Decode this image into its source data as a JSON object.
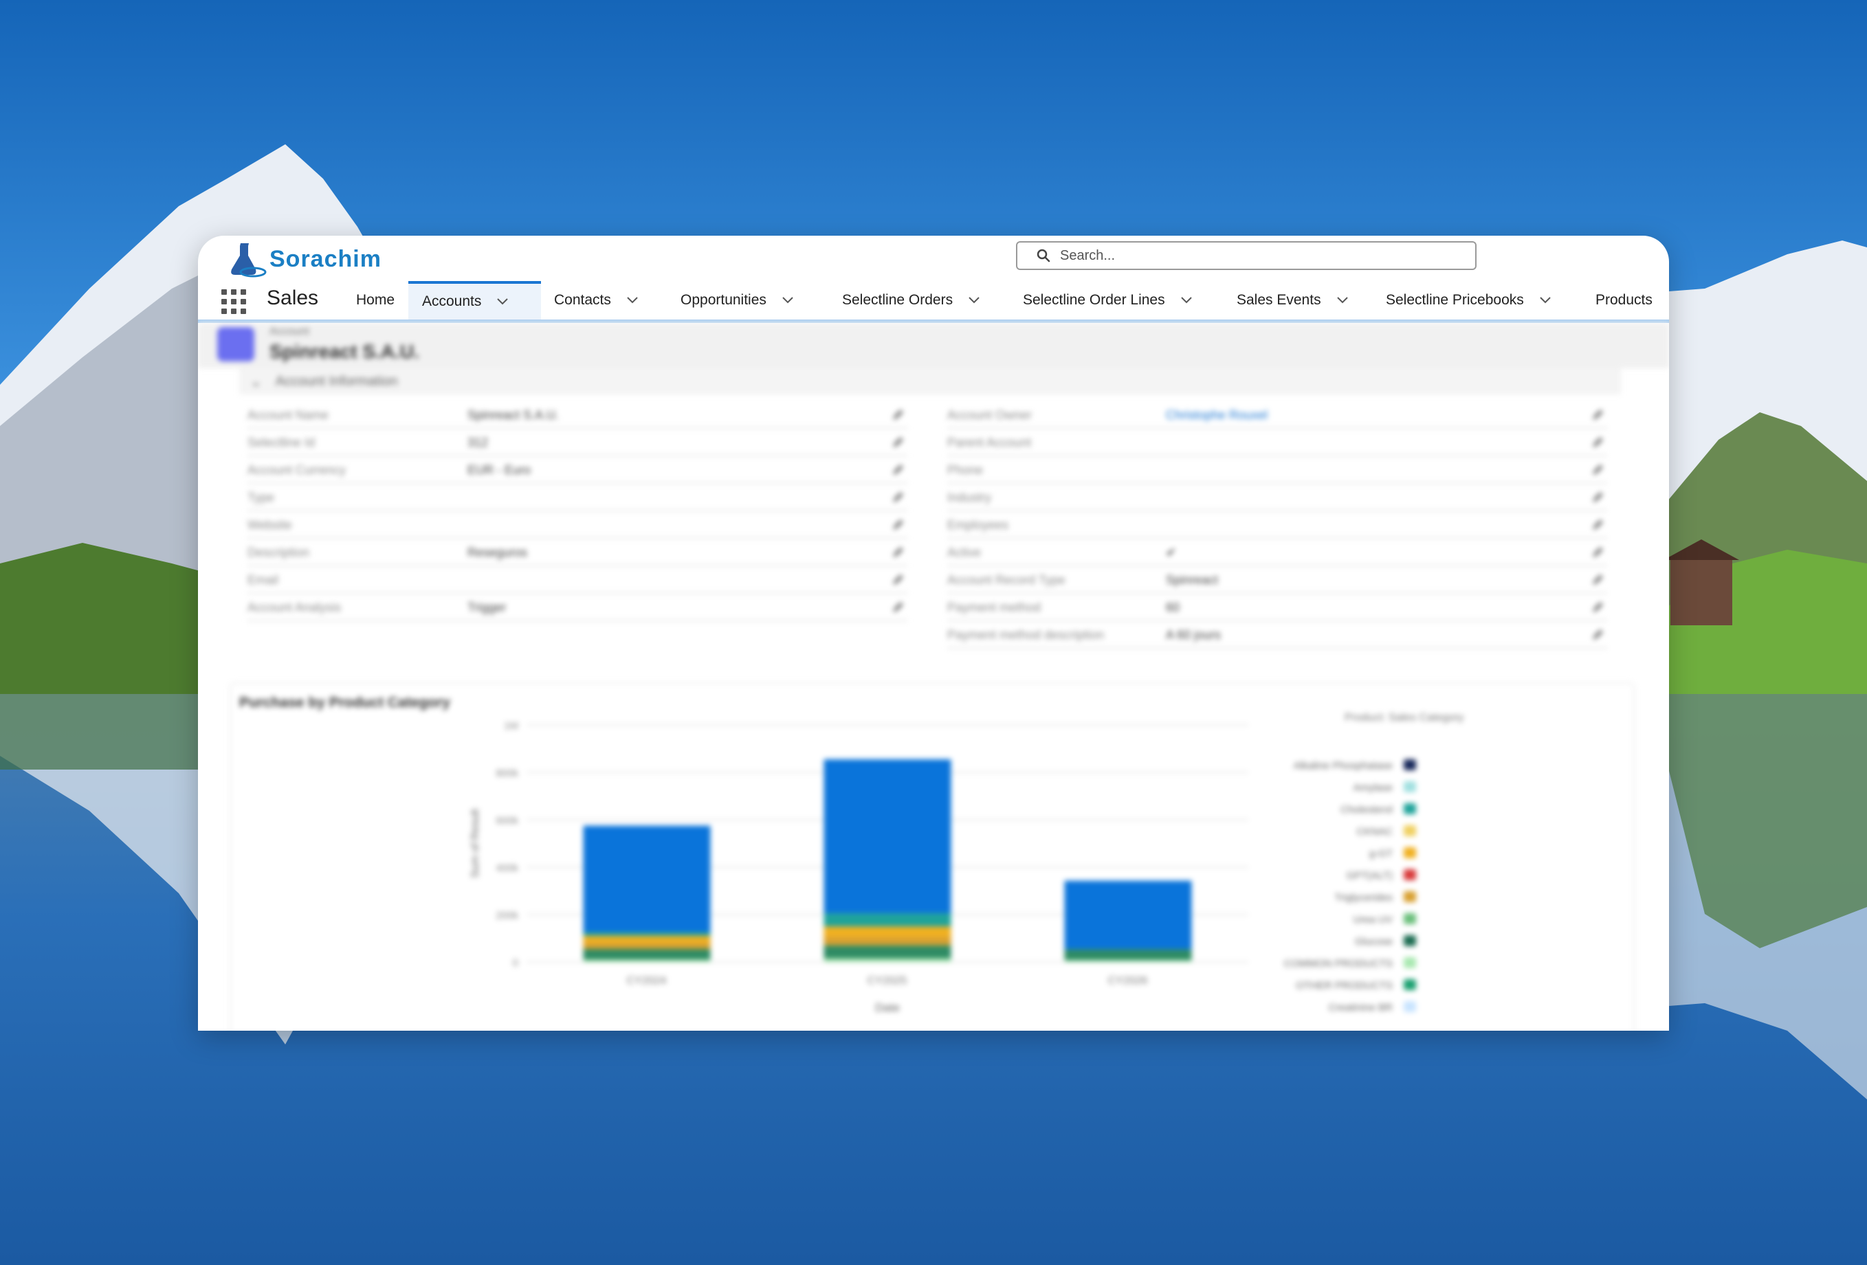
{
  "app": {
    "logo_text": "Sorachim",
    "app_name": "Sales",
    "search_placeholder": "Search..."
  },
  "nav": {
    "tabs": [
      {
        "label": "Home",
        "has_menu": false
      },
      {
        "label": "Accounts",
        "has_menu": true,
        "active": true
      },
      {
        "label": "Contacts",
        "has_menu": true
      },
      {
        "label": "Opportunities",
        "has_menu": true
      },
      {
        "label": "Selectline Orders",
        "has_menu": true
      },
      {
        "label": "Selectline Order Lines",
        "has_menu": true
      },
      {
        "label": "Sales Events",
        "has_menu": true
      },
      {
        "label": "Selectline Pricebooks",
        "has_menu": true
      },
      {
        "label": "Products",
        "has_menu": false
      }
    ]
  },
  "record": {
    "object_label": "Account",
    "title": "Spinreact S.A.U.",
    "section_title": "Account Information",
    "left_fields": [
      {
        "label": "Account Name",
        "value": "Spinreact S.A.U."
      },
      {
        "label": "Selectline Id",
        "value": "312"
      },
      {
        "label": "Account Currency",
        "value": "EUR - Euro"
      },
      {
        "label": "Type",
        "value": ""
      },
      {
        "label": "Website",
        "value": ""
      },
      {
        "label": "Description",
        "value": "Reseguros"
      },
      {
        "label": "Email",
        "value": ""
      },
      {
        "label": "Account Analysis",
        "value": "Trigger"
      }
    ],
    "right_fields": [
      {
        "label": "Account Owner",
        "value": "Christophe Rouxel"
      },
      {
        "label": "Parent Account",
        "value": ""
      },
      {
        "label": "Phone",
        "value": ""
      },
      {
        "label": "Industry",
        "value": ""
      },
      {
        "label": "Employees",
        "value": ""
      },
      {
        "label": "Active",
        "value": "✔"
      },
      {
        "label": "Account Record Type",
        "value": "Spinreact"
      },
      {
        "label": "Payment method",
        "value": "60"
      },
      {
        "label": "Payment method description",
        "value": "A 60 jours"
      }
    ]
  },
  "chart_data": {
    "type": "bar",
    "title": "Purchase by Product Category",
    "xlabel": "Date",
    "ylabel": "Sum of Result",
    "categories": [
      "CY2024",
      "CY2025",
      "CY2026"
    ],
    "y_ticks": [
      "0",
      "200k",
      "400k",
      "600k",
      "800k",
      "1M"
    ],
    "ylim": [
      0,
      1000000
    ],
    "legend_title": "Product: Sales Category",
    "series": [
      {
        "name": "Alkaline Phosphatase",
        "color": "#17285a",
        "values": [
          0,
          0,
          0
        ]
      },
      {
        "name": "Amylase",
        "color": "#a0e0e0",
        "values": [
          0,
          0,
          0
        ]
      },
      {
        "name": "Cholesterol",
        "color": "#1fa39a",
        "values": [
          0,
          0,
          0
        ]
      },
      {
        "name": "CKNAC",
        "color": "#f0d060",
        "values": [
          0,
          0,
          0
        ]
      },
      {
        "name": "g-GT",
        "color": "#f0b020",
        "values": [
          0,
          0,
          0
        ]
      },
      {
        "name": "GPT(ALT)",
        "color": "#d83a3a",
        "values": [
          0,
          0,
          0
        ]
      },
      {
        "name": "Triglycerides",
        "color": "#d8a030",
        "values": [
          0,
          0,
          0
        ]
      },
      {
        "name": "Urea UV",
        "color": "#6abf7b",
        "values": [
          0,
          0,
          0
        ]
      },
      {
        "name": "Glucose",
        "color": "#1b6b50",
        "values": [
          0,
          0,
          0
        ]
      },
      {
        "name": "COMMON PRODUCTS",
        "color": "#a8e8b0",
        "values": [
          0,
          0,
          0
        ]
      },
      {
        "name": "OTHER PRODUCTS",
        "color": "#1aa070",
        "values": [
          0,
          0,
          0
        ]
      },
      {
        "name": "Creatinine BR",
        "color": "#c8e4ff",
        "values": [
          0,
          0,
          0
        ]
      }
    ],
    "stacks": [
      [
        {
          "color": "#a8e8b0",
          "value": 10000
        },
        {
          "color": "#2e8b64",
          "value": 45000
        },
        {
          "color": "#d8a030",
          "value": 25000
        },
        {
          "color": "#f0b020",
          "value": 30000
        },
        {
          "color": "#1fa39a",
          "value": 15000
        },
        {
          "color": "#0a74da",
          "value": 450000
        }
      ],
      [
        {
          "color": "#a8e8b0",
          "value": 15000
        },
        {
          "color": "#2e8b64",
          "value": 55000
        },
        {
          "color": "#d8a030",
          "value": 35000
        },
        {
          "color": "#f0b020",
          "value": 45000
        },
        {
          "color": "#1fa39a",
          "value": 55000
        },
        {
          "color": "#0a74da",
          "value": 650000
        }
      ],
      [
        {
          "color": "#a8e8b0",
          "value": 8000
        },
        {
          "color": "#2e8b64",
          "value": 45000
        },
        {
          "color": "#0a74da",
          "value": 290000
        }
      ]
    ]
  }
}
